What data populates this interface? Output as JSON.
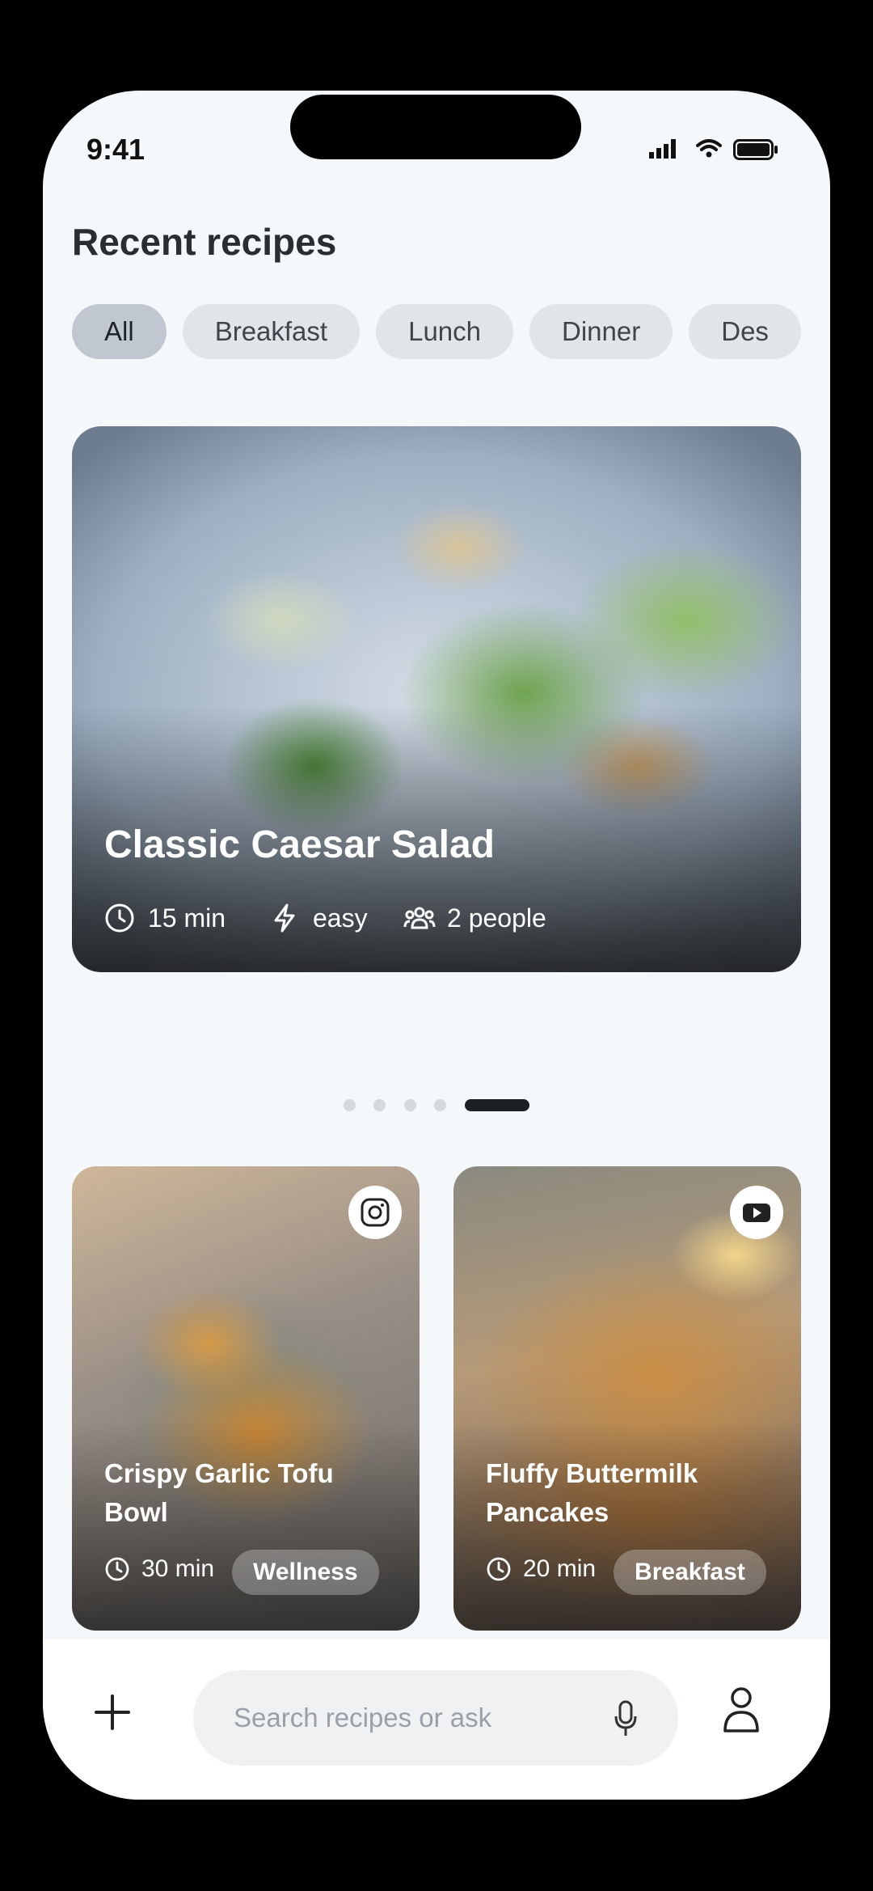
{
  "status_bar": {
    "time": "9:41"
  },
  "page": {
    "title": "Recent recipes"
  },
  "filters": [
    "All",
    "Breakfast",
    "Lunch",
    "Dinner",
    "Des"
  ],
  "featured": {
    "title": "Classic Caesar Salad",
    "time": "15 min",
    "difficulty": "easy",
    "servings": "2 people",
    "carousel": {
      "count": 5,
      "active_index": 4
    }
  },
  "recipes": [
    {
      "title": "Crispy Garlic Tofu Bowl",
      "time": "30 min",
      "tag": "Wellness",
      "source_icon": "instagram-icon"
    },
    {
      "title": "Fluffy Buttermilk Pancakes",
      "time": "20 min",
      "tag": "Breakfast",
      "source_icon": "youtube-icon"
    }
  ],
  "peek_cards": [
    {
      "source_icon": "pinterest-icon"
    },
    {
      "source_icon": "tiktok-icon"
    }
  ],
  "search": {
    "placeholder": "Search recipes or ask"
  },
  "colors": {
    "background": "#f5f8fa",
    "chip_active": "#c0c7d1",
    "chip": "#e2e5e8",
    "dot_active": "#1c1f23"
  }
}
